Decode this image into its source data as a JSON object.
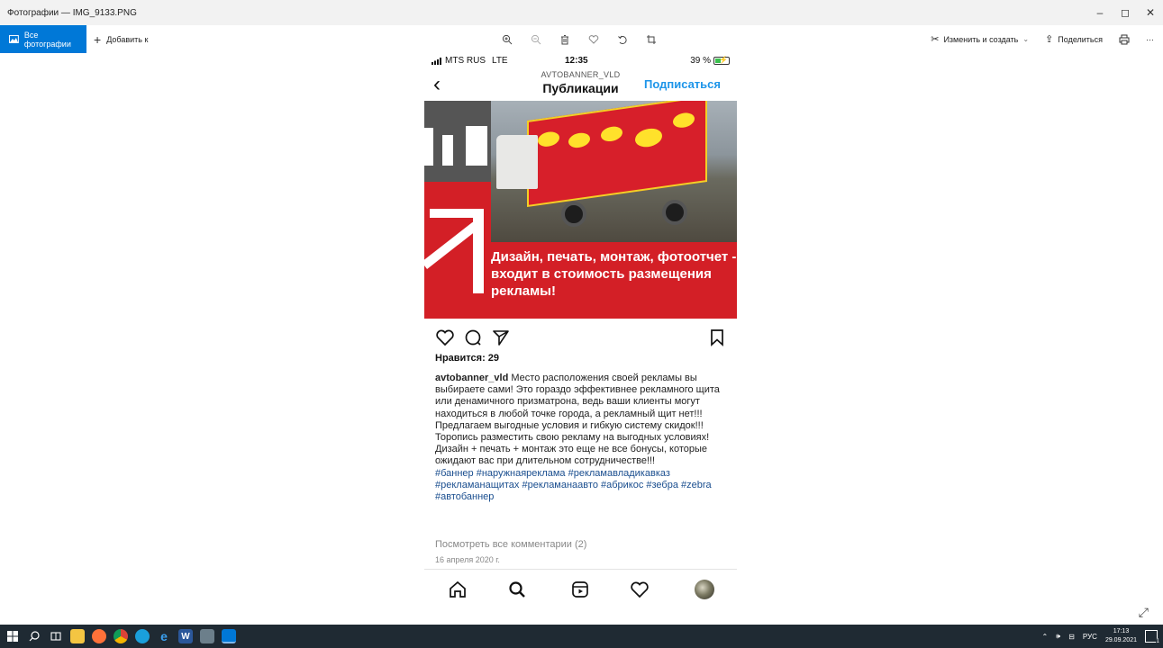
{
  "window": {
    "title": "Фотографии — IMG_9133.PNG",
    "controls": {
      "minimize": "–",
      "maximize": "◻",
      "close": "✕"
    }
  },
  "toolbar": {
    "all_photos": "Все фотографии",
    "add_to": "Добавить к",
    "edit_create": "Изменить и создать",
    "share": "Поделиться",
    "more": "···"
  },
  "phone_status": {
    "carrier": "MTS RUS",
    "network": "LTE",
    "time": "12:35",
    "battery": "39 %"
  },
  "ig": {
    "account": "AVTOBANNER_VLD",
    "page_title": "Публикации",
    "subscribe": "Подписаться",
    "banner_text": "Дизайн, печать, монтаж, фотоотчет - входит в стоимость размещения рекламы!",
    "likes": "Нравится: 29",
    "username": "avtobanner_vld",
    "caption_p1": " Место расположения своей рекламы вы выбираете сами! Это гораздо эффективнее рекламного щита или денамичного призматрона, ведь ваши клиенты могут находиться в любой точке города, а рекламный щит нет!!!",
    "caption_p2": "Предлагаем выгодные условия и гибкую систему скидок!!! Торопись разместить свою рекламу на выгодных условиях! Дизайн + печать + монтаж  это еще не все бонусы, которые ожидают вас при длительном сотрудничестве!!!",
    "hashtags": "#баннер #наружнаяреклама #рекламавладикавказ #рекламанащитах #рекламанаавто #абрикос #зебра #zebra #автобаннер",
    "view_comments": "Посмотреть все комментарии (2)",
    "date": "16 апреля 2020 г."
  },
  "taskbar": {
    "tray_lang": "РУС",
    "tray_time": "17:13",
    "tray_date": "29.09.2021",
    "notif_count": "1"
  }
}
